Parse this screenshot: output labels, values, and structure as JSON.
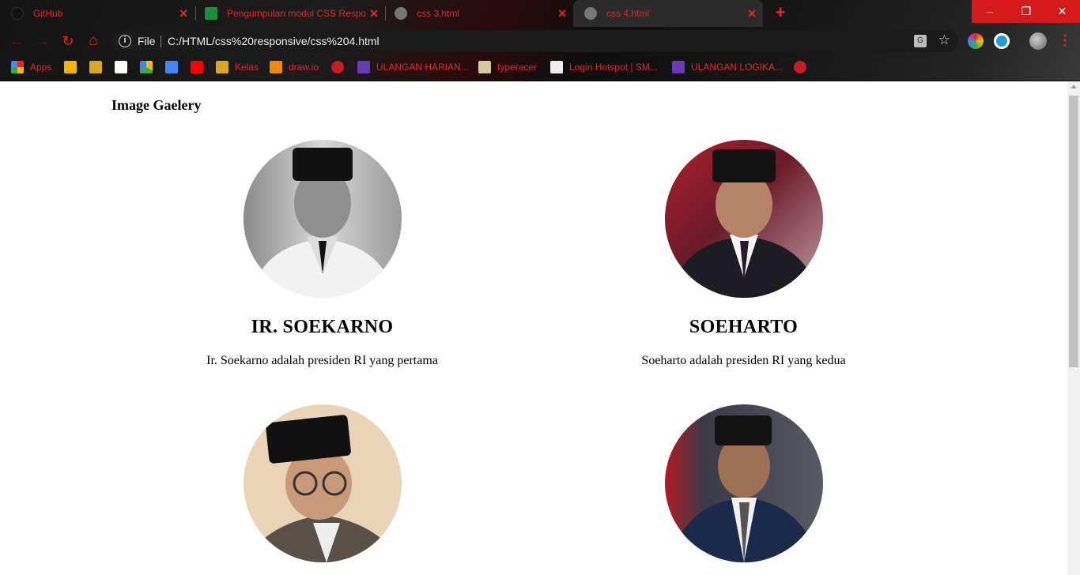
{
  "tabs": [
    {
      "title": "GitHub",
      "active": false
    },
    {
      "title": "Pengumpulan modul CSS Respon",
      "active": false
    },
    {
      "title": "css 3.html",
      "active": false
    },
    {
      "title": "css 4.html",
      "active": true
    }
  ],
  "window_controls": {
    "minimize": "–",
    "restore": "❐",
    "close": "✕"
  },
  "address_bar": {
    "scheme_label": "File",
    "url": "C:/HTML/css%20responsive/css%204.html"
  },
  "bookmarks": [
    {
      "label": "Apps",
      "icon": "apps-grid-icon"
    },
    {
      "label": "",
      "icon": "slides-icon"
    },
    {
      "label": "",
      "icon": "classroom-icon"
    },
    {
      "label": "",
      "icon": "gmail-icon"
    },
    {
      "label": "",
      "icon": "drive-icon"
    },
    {
      "label": "",
      "icon": "docs-icon"
    },
    {
      "label": "",
      "icon": "youtube-icon"
    },
    {
      "label": "Kelas",
      "icon": "classroom-icon"
    },
    {
      "label": "draw.io",
      "icon": "drawio-icon"
    },
    {
      "label": "",
      "icon": "globe-icon"
    },
    {
      "label": "ULANGAN HARIAN...",
      "icon": "forms-icon"
    },
    {
      "label": "typeracer",
      "icon": "typeracer-icon"
    },
    {
      "label": "Login Hotspot | SM...",
      "icon": "hotspot-icon"
    },
    {
      "label": "ULANGAN LOGIKA...",
      "icon": "forms-icon"
    },
    {
      "label": "",
      "icon": "globe-icon"
    }
  ],
  "page": {
    "title": "Image Gaelery",
    "cards": [
      {
        "name": "IR. SOEKARNO",
        "description": "Ir. Soekarno adalah presiden RI yang pertama",
        "photo": "bw"
      },
      {
        "name": "SOEHARTO",
        "description": "Soeharto adalah presiden RI yang kedua",
        "photo": "color-red"
      },
      {
        "name": "",
        "description": "",
        "photo": "color-warm"
      },
      {
        "name": "",
        "description": "",
        "photo": "color-cool"
      }
    ]
  },
  "colors": {
    "accent": "#e8252a",
    "chrome_bg": "#1a1a1a",
    "window_close": "#d41a1a"
  }
}
